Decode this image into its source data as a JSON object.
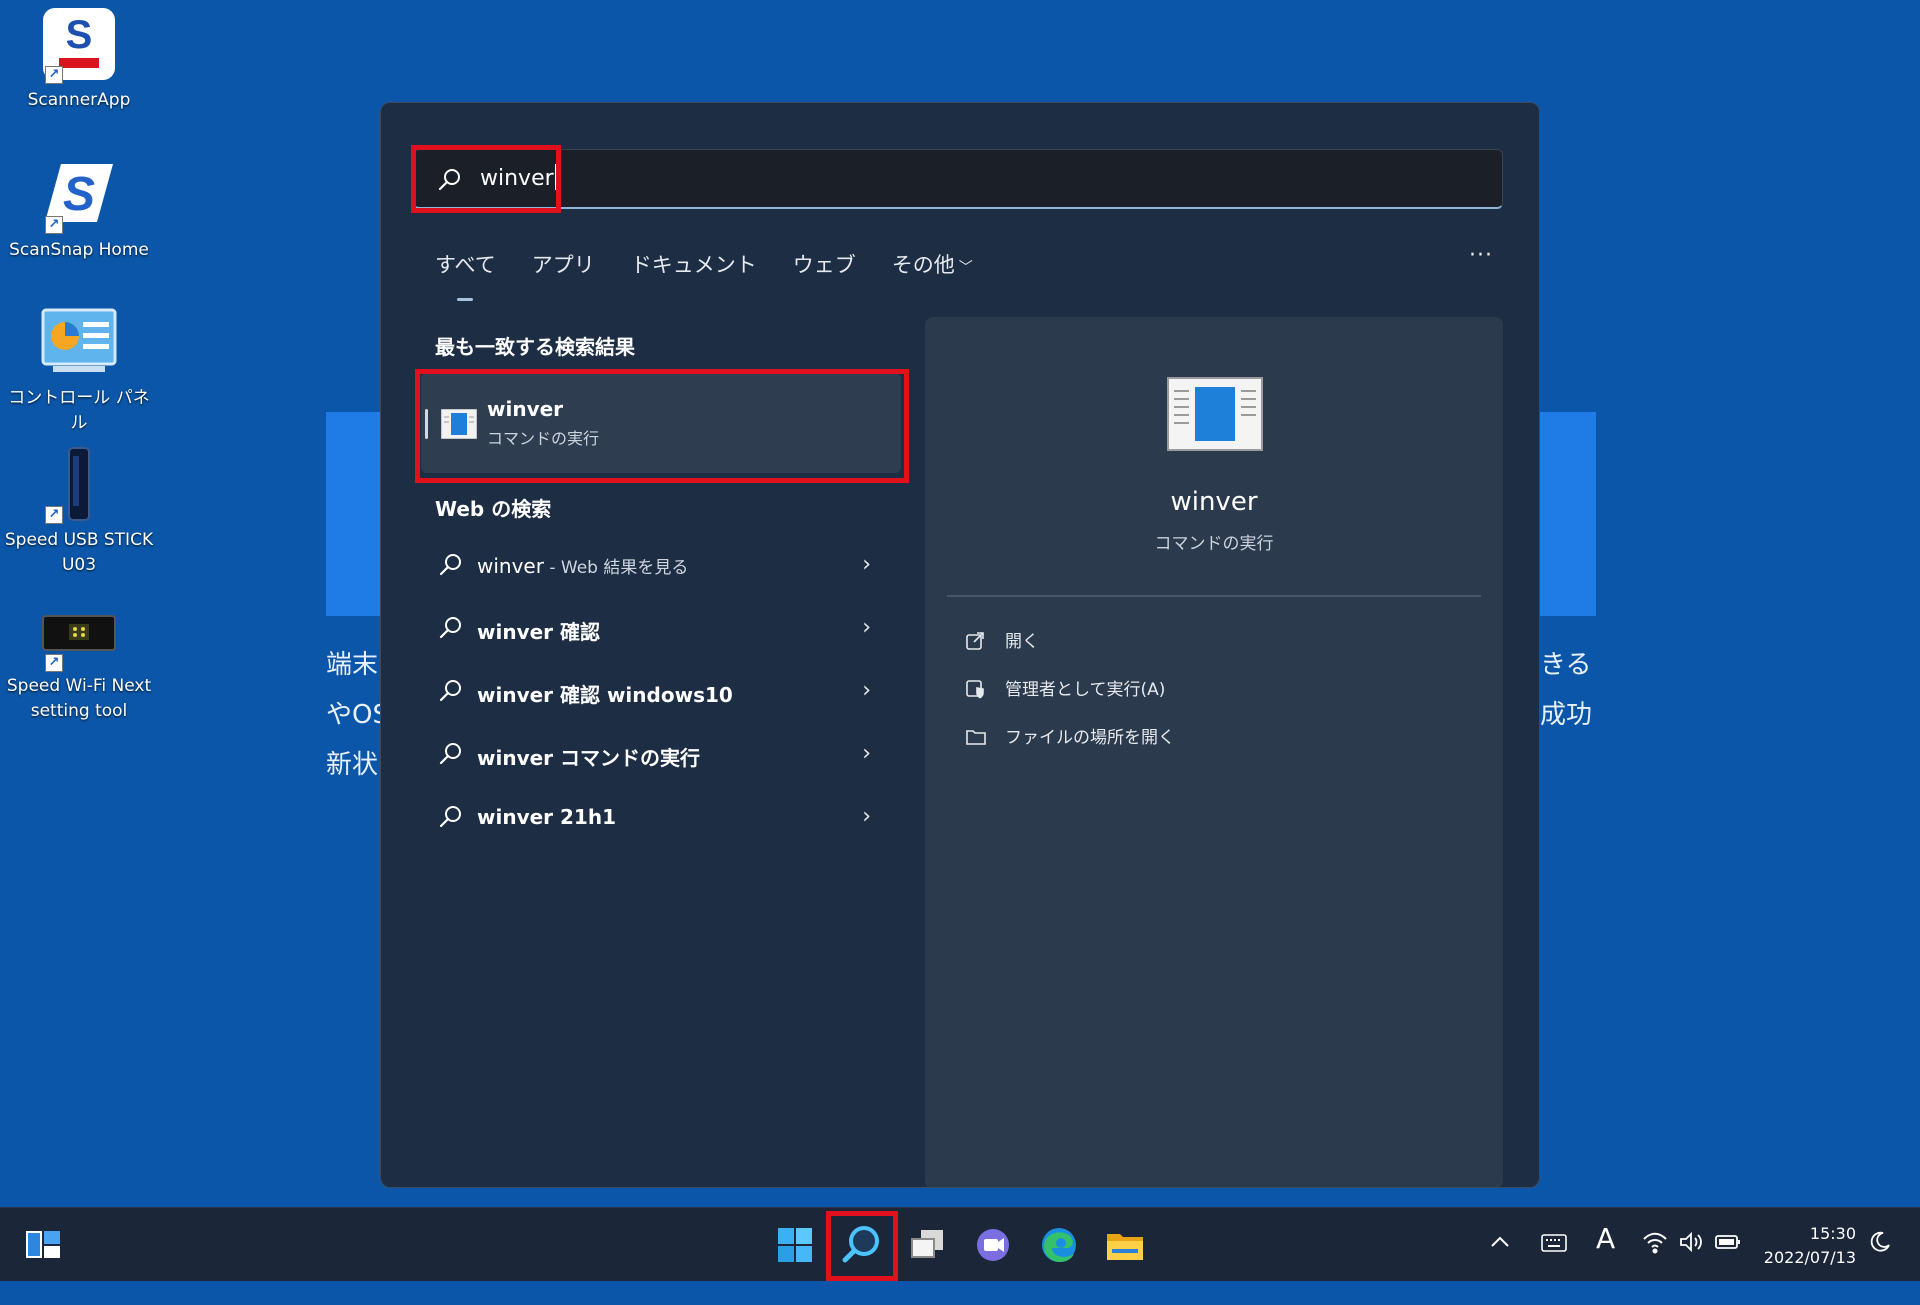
{
  "desktop": {
    "icons": [
      {
        "label": "ScannerApp"
      },
      {
        "label": "ScanSnap Home"
      },
      {
        "label": "コントロール パネル"
      },
      {
        "label": "Speed USB STICK U03"
      },
      {
        "label": "Speed Wi-Fi Next setting tool"
      }
    ],
    "background_text": {
      "left": [
        "端末",
        "やOS",
        "新状"
      ],
      "right": [
        "きる",
        "成功"
      ]
    }
  },
  "search": {
    "query": "winver",
    "tabs": [
      "すべて",
      "アプリ",
      "ドキュメント",
      "ウェブ",
      "その他"
    ],
    "more_label": "···",
    "best_match_header": "最も一致する検索結果",
    "best_match": {
      "title": "winver",
      "subtitle": "コマンドの実行"
    },
    "web_header": "Web の検索",
    "web_results": [
      {
        "bold": "winver",
        "rest": " - Web 結果を見る"
      },
      {
        "bold": "winver 確認",
        "rest": ""
      },
      {
        "bold": "winver 確認 windows10",
        "rest": ""
      },
      {
        "bold": "winver コマンドの実行",
        "rest": ""
      },
      {
        "bold": "winver 21h1",
        "rest": ""
      }
    ],
    "preview": {
      "title": "winver",
      "subtitle": "コマンドの実行",
      "actions": [
        "開く",
        "管理者として実行(A)",
        "ファイルの場所を開く"
      ]
    }
  },
  "taskbar": {
    "time": "15:30",
    "date": "2022/07/13",
    "ime_label": "A"
  },
  "colors": {
    "desktop": "#0b56a8",
    "panel": "#1d2d44",
    "highlight": "#e0101c",
    "taskbar": "#1b2638"
  }
}
